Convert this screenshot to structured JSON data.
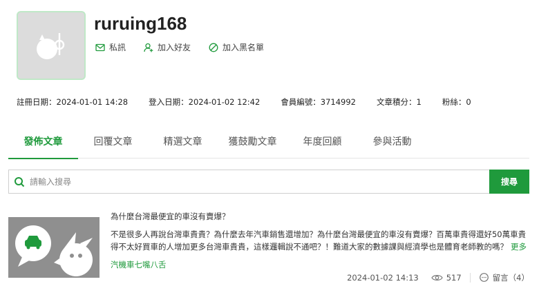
{
  "profile": {
    "username": "ruruing168",
    "actions": {
      "message_label": "私訊",
      "add_friend_label": "加入好友",
      "blacklist_label": "加入黑名單"
    },
    "stats": {
      "register_date": "註冊日期：2024-01-01 14:28",
      "login_date": "登入日期：2024-01-02 12:42",
      "member_id": "會員編號：3714992",
      "article_points": "文章積分：1",
      "fans": "粉絲：0"
    }
  },
  "tabs": [
    {
      "label": "發佈文章",
      "active": true
    },
    {
      "label": "回覆文章",
      "active": false
    },
    {
      "label": "精選文章",
      "active": false
    },
    {
      "label": "獲鼓勵文章",
      "active": false
    },
    {
      "label": "年度回顧",
      "active": false
    },
    {
      "label": "參與活動",
      "active": false
    }
  ],
  "search": {
    "placeholder": "請輸入搜尋",
    "button_label": "搜尋"
  },
  "articles": [
    {
      "title": "為什麼台灣最便宜的車沒有賣爆？",
      "excerpt": "不是很多人再說台灣車貴貴？為什麼去年汽車銷售還增加？為什麼台灣最便宜的車沒有賣爆？百萬車貴得還好50萬車貴得不太好買車的人增加更多台灣車貴貴，這樣邏輯說不通吧？！難道大家的數據課與經濟學也是體育老師教的嗎？",
      "more_label": "更多",
      "category": "汽機車七嘴八舌",
      "date": "2024-01-02 14:13",
      "views": "517",
      "comments": "留言（4）"
    }
  ],
  "colors": {
    "accent": "#1f9a3c",
    "avatar_bg": "#dcdcdc",
    "avatar_border": "#bfe8c7",
    "thumb_bg": "#8f8f8f"
  },
  "icons": {
    "message": "envelope-icon",
    "add_friend": "user-plus-icon",
    "blacklist": "ban-icon",
    "search": "search-icon",
    "views": "eye-icon",
    "comments": "chat-bubble-icon"
  }
}
